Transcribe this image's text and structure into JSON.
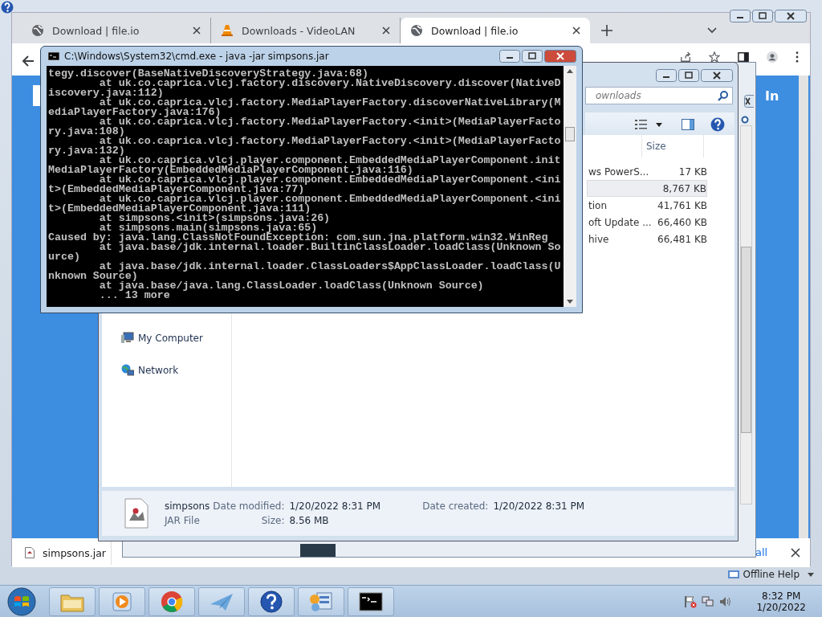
{
  "help_window": {
    "footer": "Offline Help"
  },
  "browser": {
    "tabs": [
      {
        "title": "Download | file.io",
        "kind": "globe",
        "selected": false
      },
      {
        "title": "Downloads - VideoLAN",
        "kind": "cone",
        "selected": false
      },
      {
        "title": "Download | file.io",
        "kind": "globe",
        "selected": true
      }
    ],
    "page_heading": "In",
    "download_bar": {
      "file": "simpsons.jar",
      "show_all": "all"
    }
  },
  "explorer": {
    "search": {
      "placeholder": "ownloads"
    },
    "columns": [
      "Size"
    ],
    "rows": [
      {
        "name": "ws PowerS...",
        "size": "17 KB",
        "selected": false
      },
      {
        "size": "8,767 KB",
        "selected": true
      },
      {
        "name": "tion",
        "size": "41,761 KB",
        "selected": false
      },
      {
        "name": "oft Update ...",
        "size": "66,460 KB",
        "selected": false
      },
      {
        "name": "hive",
        "size": "66,481 KB",
        "selected": false
      }
    ],
    "nav": [
      {
        "label": "My Computer",
        "kind": "computer"
      },
      {
        "label": "Network",
        "kind": "network"
      }
    ],
    "details": {
      "name": "simpsons",
      "type": "JAR File",
      "fields": [
        {
          "label": "Date modified:",
          "value": "1/20/2022 8:31 PM"
        },
        {
          "label": "Size:",
          "value": "8.56 MB"
        },
        {
          "label": "Date created:",
          "value": "1/20/2022 8:31 PM"
        }
      ]
    }
  },
  "console": {
    "title": "C:\\Windows\\System32\\cmd.exe - java  -jar simpsons.jar",
    "lines": [
      "tegy.discover(BaseNativeDiscoveryStrategy.java:68)",
      "        at uk.co.caprica.vlcj.factory.discovery.NativeDiscovery.discover(NativeD",
      "iscovery.java:112)",
      "        at uk.co.caprica.vlcj.factory.MediaPlayerFactory.discoverNativeLibrary(M",
      "ediaPlayerFactory.java:176)",
      "        at uk.co.caprica.vlcj.factory.MediaPlayerFactory.<init>(MediaPlayerFacto",
      "ry.java:108)",
      "        at uk.co.caprica.vlcj.factory.MediaPlayerFactory.<init>(MediaPlayerFacto",
      "ry.java:132)",
      "        at uk.co.caprica.vlcj.player.component.EmbeddedMediaPlayerComponent.init",
      "MediaPlayerFactory(EmbeddedMediaPlayerComponent.java:116)",
      "        at uk.co.caprica.vlcj.player.component.EmbeddedMediaPlayerComponent.<ini",
      "t>(EmbeddedMediaPlayerComponent.java:77)",
      "        at uk.co.caprica.vlcj.player.component.EmbeddedMediaPlayerComponent.<ini",
      "t>(EmbeddedMediaPlayerComponent.java:111)",
      "        at simpsons.<init>(simpsons.java:26)",
      "        at simpsons.main(simpsons.java:65)",
      "Caused by: java.lang.ClassNotFoundException: com.sun.jna.platform.win32.WinReg",
      "        at java.base/jdk.internal.loader.BuiltinClassLoader.loadClass(Unknown So",
      "urce)",
      "        at java.base/jdk.internal.loader.ClassLoaders$AppClassLoader.loadClass(U",
      "nknown Source)",
      "        at java.base/java.lang.ClassLoader.loadClass(Unknown Source)",
      "        ... 13 more"
    ]
  },
  "taskbar": {
    "apps": [
      {
        "kind": "folder"
      },
      {
        "kind": "player"
      },
      {
        "kind": "chrome"
      },
      {
        "kind": "plane"
      },
      {
        "kind": "help"
      },
      {
        "kind": "panel"
      },
      {
        "kind": "cmd"
      }
    ],
    "time": "8:32 PM",
    "date": "1/20/2022"
  }
}
